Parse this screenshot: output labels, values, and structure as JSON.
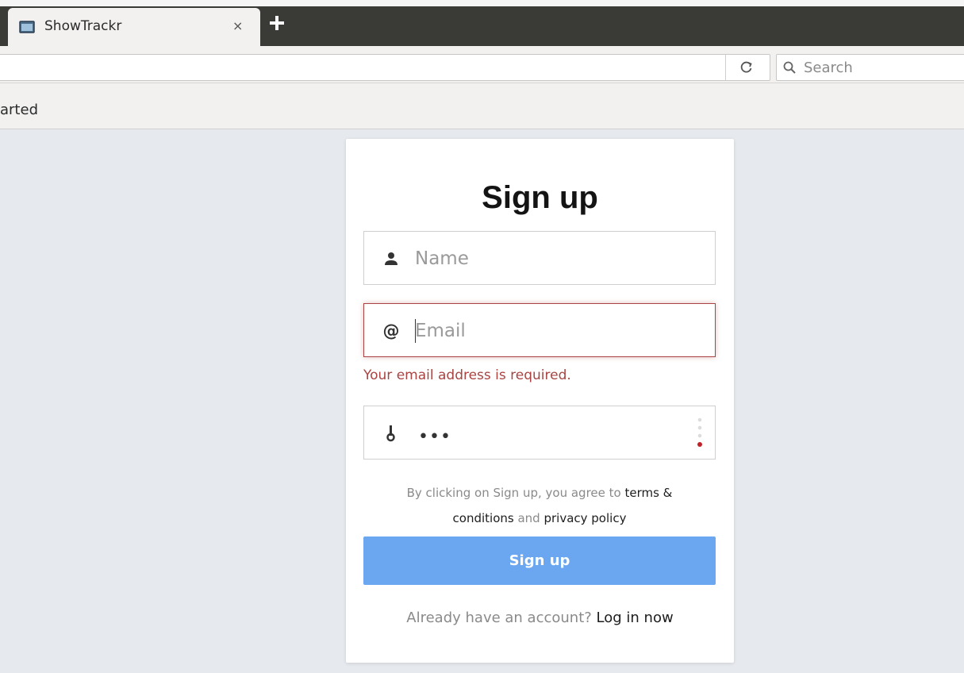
{
  "browser": {
    "tab_title": "ShowTrackr",
    "tab_close": "×",
    "new_tab": "+",
    "search_placeholder": "Search",
    "bookmark_item": "arted"
  },
  "signup": {
    "title": "Sign up",
    "name_placeholder": "Name",
    "email_placeholder": "Email",
    "email_error": "Your email address is required.",
    "password_mask": "•••",
    "terms_prefix": "By clicking on Sign up, you agree to ",
    "terms_link": "terms & conditions",
    "terms_and": " and ",
    "privacy_link": "privacy policy",
    "button_label": "Sign up",
    "login_prompt": "Already have an account? ",
    "login_link": "Log in now"
  },
  "colors": {
    "error": "#a94442",
    "button": "#6aa7f0",
    "page_bg": "#e6e9ee",
    "tab_strip": "#3a3a36"
  },
  "icons": {
    "tab": "window-icon",
    "reload": "reload-icon",
    "search": "search-icon",
    "name": "user-icon",
    "email": "at-icon",
    "password": "key-icon",
    "strength": "strength-meter-icon"
  }
}
